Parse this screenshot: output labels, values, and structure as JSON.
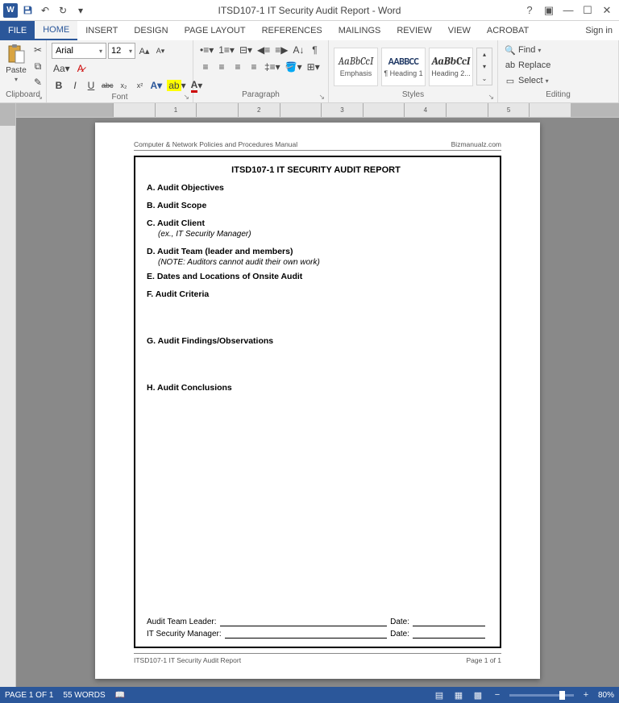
{
  "titlebar": {
    "app_icon_text": "W",
    "title": "ITSD107-1 IT Security Audit Report - Word",
    "help_tip": "?",
    "ribbon_opts_tip": "Ribbon Options"
  },
  "tabs": {
    "file": "FILE",
    "home": "HOME",
    "insert": "INSERT",
    "design": "DESIGN",
    "page_layout": "PAGE LAYOUT",
    "references": "REFERENCES",
    "mailings": "MAILINGS",
    "review": "REVIEW",
    "view": "VIEW",
    "acrobat": "ACROBAT",
    "signin": "Sign in"
  },
  "ribbon": {
    "clipboard": {
      "label": "Clipboard",
      "paste": "Paste"
    },
    "font": {
      "label": "Font",
      "name": "Arial",
      "size": "12",
      "bold": "B",
      "italic": "I",
      "underline": "U",
      "strike": "abc",
      "sub": "x₂",
      "sup": "x²"
    },
    "paragraph": {
      "label": "Paragraph"
    },
    "styles": {
      "label": "Styles",
      "items": [
        {
          "preview": "AaBbCcI",
          "name": "Emphasis"
        },
        {
          "preview": "AABBCC",
          "name": "¶ Heading 1"
        },
        {
          "preview": "AaBbCcI",
          "name": "Heading 2..."
        }
      ]
    },
    "editing": {
      "label": "Editing",
      "find": "Find",
      "replace": "Replace",
      "select": "Select"
    }
  },
  "ruler": {
    "marks": [
      "",
      "1",
      "",
      "2",
      "",
      "3",
      "",
      "4",
      "",
      "5",
      ""
    ]
  },
  "document": {
    "header_left": "Computer & Network Policies and Procedures Manual",
    "header_right": "Bizmanualz.com",
    "title": "ITSD107-1   IT SECURITY AUDIT REPORT",
    "sections": [
      {
        "h": "A.  Audit Objectives",
        "sub": ""
      },
      {
        "h": "B.  Audit Scope",
        "sub": ""
      },
      {
        "h": "C.  Audit Client",
        "sub": "(ex., IT Security Manager)"
      },
      {
        "h": "D.  Audit Team (leader and members)",
        "sub": "(NOTE: Auditors cannot audit their own work)"
      },
      {
        "h": "E.  Dates and Locations of Onsite Audit",
        "sub": ""
      },
      {
        "h": "F.  Audit Criteria",
        "sub": ""
      },
      {
        "h": "G.  Audit Findings/Observations",
        "sub": ""
      },
      {
        "h": "H.  Audit Conclusions",
        "sub": ""
      }
    ],
    "sig1_label": "Audit Team Leader:",
    "sig2_label": "IT Security Manager:",
    "date_label": "Date:",
    "footer_left": "ITSD107-1 IT Security Audit Report",
    "footer_right": "Page 1 of 1"
  },
  "statusbar": {
    "page": "PAGE 1 OF 1",
    "words": "55 WORDS",
    "zoom": "80%"
  }
}
